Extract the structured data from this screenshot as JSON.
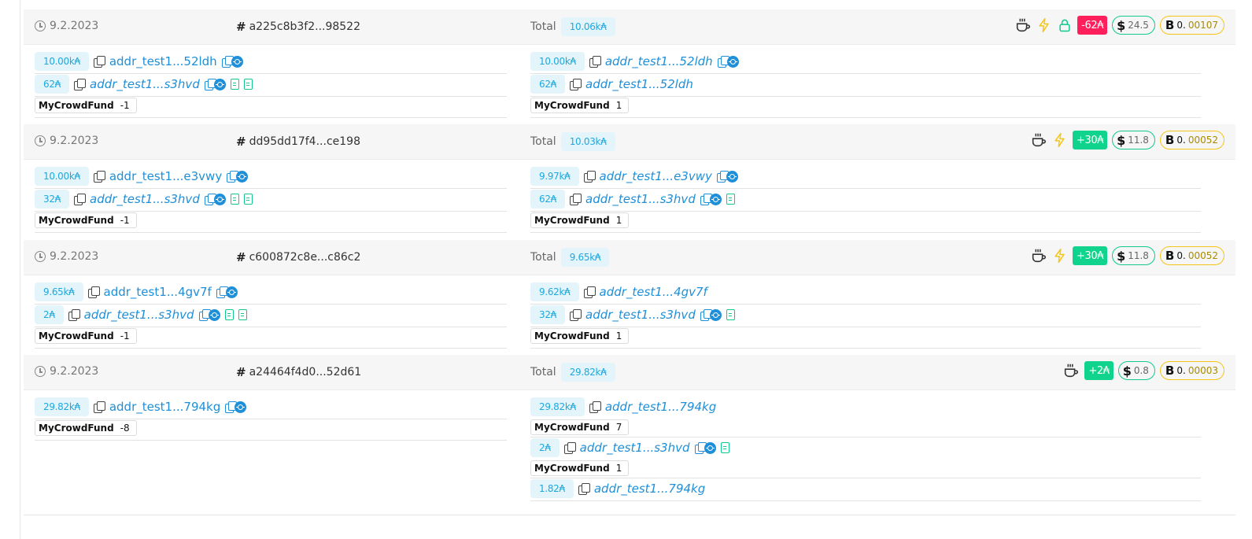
{
  "colors": {
    "input_pill_bg": "#e3f4fb",
    "address": "#1e8fd8",
    "negative": "#ff1f5a",
    "positive": "#10d48e",
    "usd_border": "#10c98a",
    "btc_border": "#f5c518"
  },
  "transactions": [
    {
      "date": "9.2.2023",
      "hash": "a225c8b3f2...98522",
      "total_label": "Total",
      "total": "10.06k₳",
      "has_lock": true,
      "delta": "-62₳",
      "delta_kind": "neg",
      "usd": "24.5",
      "btc_lead": "0.",
      "btc_rest": "00107",
      "inputs": [
        {
          "amount": "10.00k₳",
          "address": "addr_test1...52ldh",
          "italic": false,
          "script": true,
          "docs": 0
        },
        {
          "amount": "62₳",
          "address": "addr_test1...s3hvd",
          "italic": true,
          "script": true,
          "docs": 2
        }
      ],
      "input_token": {
        "name": "MyCrowdFund",
        "qty": "-1"
      },
      "outputs": [
        {
          "amount": "10.00k₳",
          "address": "addr_test1...52ldh",
          "italic": true,
          "script": true,
          "docs": 0
        },
        {
          "amount": "62₳",
          "address": "addr_test1...52ldh",
          "italic": true,
          "script": false,
          "docs": 0
        }
      ],
      "output_token": {
        "name": "MyCrowdFund",
        "qty": "1"
      }
    },
    {
      "date": "9.2.2023",
      "hash": "dd95dd17f4...ce198",
      "total_label": "Total",
      "total": "10.03k₳",
      "has_lock": false,
      "delta": "+30₳",
      "delta_kind": "pos",
      "usd": "11.8",
      "btc_lead": "0.",
      "btc_rest": "00052",
      "inputs": [
        {
          "amount": "10.00k₳",
          "address": "addr_test1...e3vwy",
          "italic": false,
          "script": true,
          "docs": 0
        },
        {
          "amount": "32₳",
          "address": "addr_test1...s3hvd",
          "italic": true,
          "script": true,
          "docs": 2
        }
      ],
      "input_token": {
        "name": "MyCrowdFund",
        "qty": "-1"
      },
      "outputs": [
        {
          "amount": "9.97k₳",
          "address": "addr_test1...e3vwy",
          "italic": true,
          "script": true,
          "docs": 0
        },
        {
          "amount": "62₳",
          "address": "addr_test1...s3hvd",
          "italic": true,
          "script": true,
          "docs": 1
        }
      ],
      "output_token": {
        "name": "MyCrowdFund",
        "qty": "1"
      }
    },
    {
      "date": "9.2.2023",
      "hash": "c600872c8e...c86c2",
      "total_label": "Total",
      "total": "9.65k₳",
      "has_lock": false,
      "delta": "+30₳",
      "delta_kind": "pos",
      "usd": "11.8",
      "btc_lead": "0.",
      "btc_rest": "00052",
      "inputs": [
        {
          "amount": "9.65k₳",
          "address": "addr_test1...4gv7f",
          "italic": false,
          "script": true,
          "docs": 0
        },
        {
          "amount": "2₳",
          "address": "addr_test1...s3hvd",
          "italic": true,
          "script": true,
          "docs": 2
        }
      ],
      "input_token": {
        "name": "MyCrowdFund",
        "qty": "-1"
      },
      "outputs": [
        {
          "amount": "9.62k₳",
          "address": "addr_test1...4gv7f",
          "italic": true,
          "script": false,
          "docs": 0
        },
        {
          "amount": "32₳",
          "address": "addr_test1...s3hvd",
          "italic": true,
          "script": true,
          "docs": 1
        }
      ],
      "output_token": {
        "name": "MyCrowdFund",
        "qty": "1"
      }
    },
    {
      "date": "9.2.2023",
      "hash": "a24464f4d0...52d61",
      "total_label": "Total",
      "total": "29.82k₳",
      "has_lock": false,
      "has_bolt": false,
      "delta": "+2₳",
      "delta_kind": "pos",
      "usd": "0.8",
      "btc_lead": "0.",
      "btc_rest": "00003",
      "inputs": [
        {
          "amount": "29.82k₳",
          "address": "addr_test1...794kg",
          "italic": false,
          "script": true,
          "docs": 0
        }
      ],
      "input_token": {
        "name": "MyCrowdFund",
        "qty": "-8"
      },
      "outputs": [
        {
          "amount": "29.82k₳",
          "address": "addr_test1...794kg",
          "italic": true,
          "script": false,
          "docs": 0,
          "token": {
            "name": "MyCrowdFund",
            "qty": "7"
          }
        },
        {
          "amount": "2₳",
          "address": "addr_test1...s3hvd",
          "italic": true,
          "script": true,
          "docs": 1,
          "token": {
            "name": "MyCrowdFund",
            "qty": "1"
          }
        },
        {
          "amount": "1.82₳",
          "address": "addr_test1...794kg",
          "italic": true,
          "script": false,
          "docs": 0
        }
      ]
    }
  ]
}
